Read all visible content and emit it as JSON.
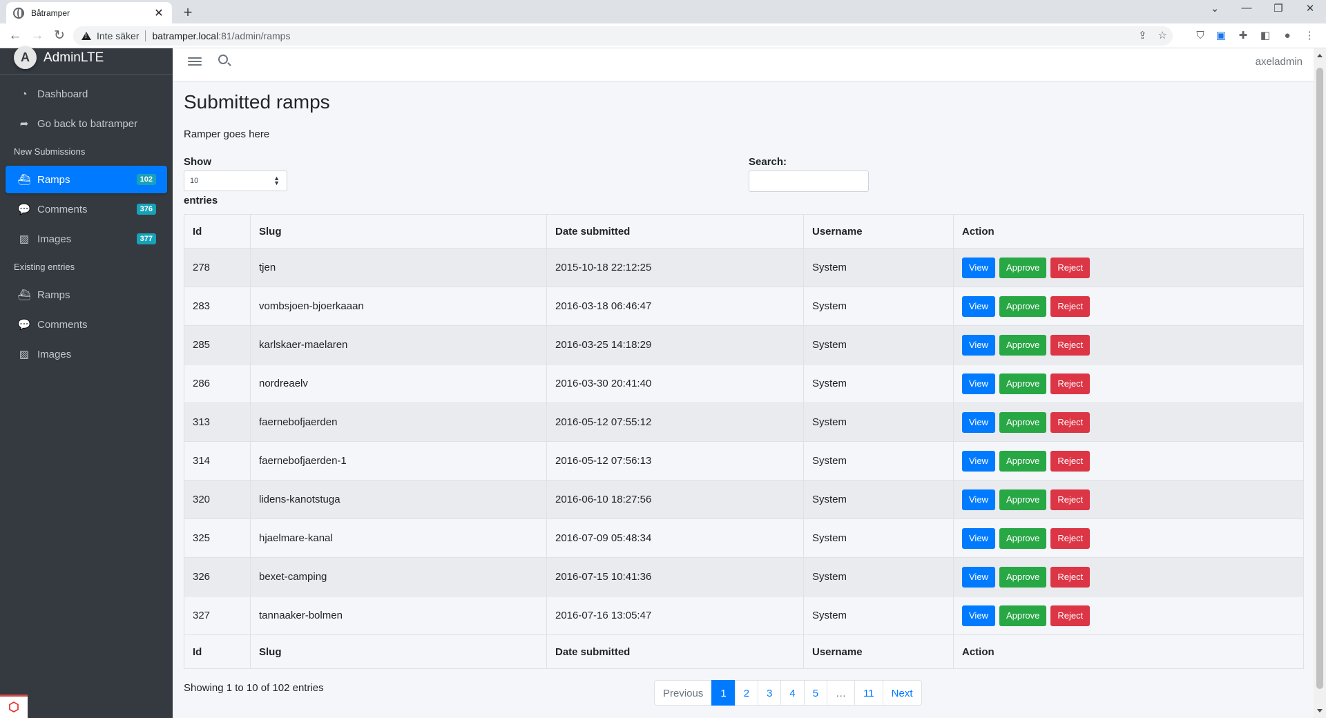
{
  "browser": {
    "tab_title": "Båtramper",
    "insecure_label": "Inte säker",
    "url_host": "batramper.local",
    "url_path": ":81/admin/ramps"
  },
  "sidebar": {
    "brand_bold": "Admin",
    "brand_light": "LTE",
    "items": [
      {
        "label": "Dashboard",
        "icon": "dashboard-icon"
      },
      {
        "label": "Go back to batramper",
        "icon": "share-icon"
      }
    ],
    "new_header": "New Submissions",
    "new_items": [
      {
        "label": "Ramps",
        "icon": "ship-icon",
        "badge": "102",
        "active": true
      },
      {
        "label": "Comments",
        "icon": "comments-icon",
        "badge": "376"
      },
      {
        "label": "Images",
        "icon": "images-icon",
        "badge": "377"
      }
    ],
    "existing_header": "Existing entries",
    "existing_items": [
      {
        "label": "Ramps",
        "icon": "ship-icon"
      },
      {
        "label": "Comments",
        "icon": "comments-icon"
      },
      {
        "label": "Images",
        "icon": "images-icon"
      }
    ]
  },
  "topnav": {
    "user": "axeladmin"
  },
  "main": {
    "title": "Submitted ramps",
    "subtitle": "Ramper goes here",
    "show_label": "Show",
    "show_value": "10",
    "entries_label": "entries",
    "search_label": "Search:",
    "columns": [
      "Id",
      "Slug",
      "Date submitted",
      "Username",
      "Action"
    ],
    "actions": [
      "View",
      "Approve",
      "Reject"
    ],
    "rows": [
      [
        "278",
        "tjen",
        "2015-10-18 22:12:25",
        "System"
      ],
      [
        "283",
        "vombsjoen-bjoerkaaan",
        "2016-03-18 06:46:47",
        "System"
      ],
      [
        "285",
        "karlskaer-maelaren",
        "2016-03-25 14:18:29",
        "System"
      ],
      [
        "286",
        "nordreaelv",
        "2016-03-30 20:41:40",
        "System"
      ],
      [
        "313",
        "faernebofjaerden",
        "2016-05-12 07:55:12",
        "System"
      ],
      [
        "314",
        "faernebofjaerden-1",
        "2016-05-12 07:56:13",
        "System"
      ],
      [
        "320",
        "lidens-kanotstuga",
        "2016-06-10 18:27:56",
        "System"
      ],
      [
        "325",
        "hjaelmare-kanal",
        "2016-07-09 05:48:34",
        "System"
      ],
      [
        "326",
        "bexet-camping",
        "2016-07-15 10:41:36",
        "System"
      ],
      [
        "327",
        "tannaaker-bolmen",
        "2016-07-16 13:05:47",
        "System"
      ]
    ],
    "info": "Showing 1 to 10 of 102 entries",
    "pagination": [
      "Previous",
      "1",
      "2",
      "3",
      "4",
      "5",
      "…",
      "11",
      "Next"
    ]
  }
}
